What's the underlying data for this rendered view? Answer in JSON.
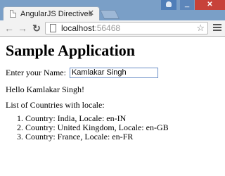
{
  "browser": {
    "tab_title": "AngularJS Directives",
    "url_host": "localhost",
    "url_port": ":56468"
  },
  "page": {
    "heading": "Sample Application",
    "name_label": "Enter your Name:",
    "name_value": "Kamlakar Singh",
    "greeting": "Hello Kamlakar Singh!",
    "list_heading": "List of Countries with locale:",
    "countries": [
      "Country: India, Locale: en-IN",
      "Country: United Kingdom, Locale: en-GB",
      "Country: France, Locale: en-FR"
    ]
  }
}
